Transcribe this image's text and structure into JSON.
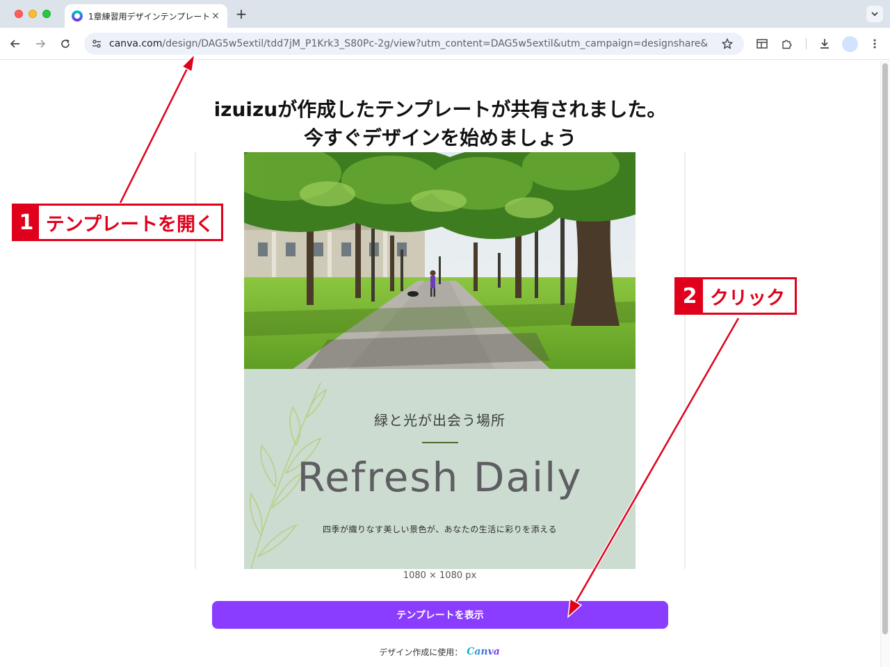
{
  "browser": {
    "tab_title": "1章練習用デザインテンプレート",
    "tab_close": "×",
    "new_tab": "+",
    "url_host": "canva.com",
    "url_path": "/design/DAG5w5extil/tdd7jM_P1Krk3_S80Pc-2g/view?utm_content=DAG5w5extil&utm_campaign=designshare&utm_..."
  },
  "page": {
    "headline_line1": "izuizuが作成したテンプレートが共有されました。",
    "headline_line2": "今すぐデザインを始めましょう",
    "design": {
      "subtitle": "緑と光が出会う場所",
      "title": "Refresh Daily",
      "description": "四季が織りなす美しい景色が、あなたの生活に彩りを添える"
    },
    "size_label": "1080 × 1080 px",
    "cta_label": "テンプレートを表示",
    "footer_text": "デザイン作成に使用：",
    "footer_brand": "Canva"
  },
  "annotations": [
    {
      "number": "1",
      "text": "テンプレートを開く"
    },
    {
      "number": "2",
      "text": "クリック"
    }
  ],
  "colors": {
    "cta": "#8b3dff",
    "annotation": "#e0001b",
    "panel": "#ccdcd0"
  }
}
